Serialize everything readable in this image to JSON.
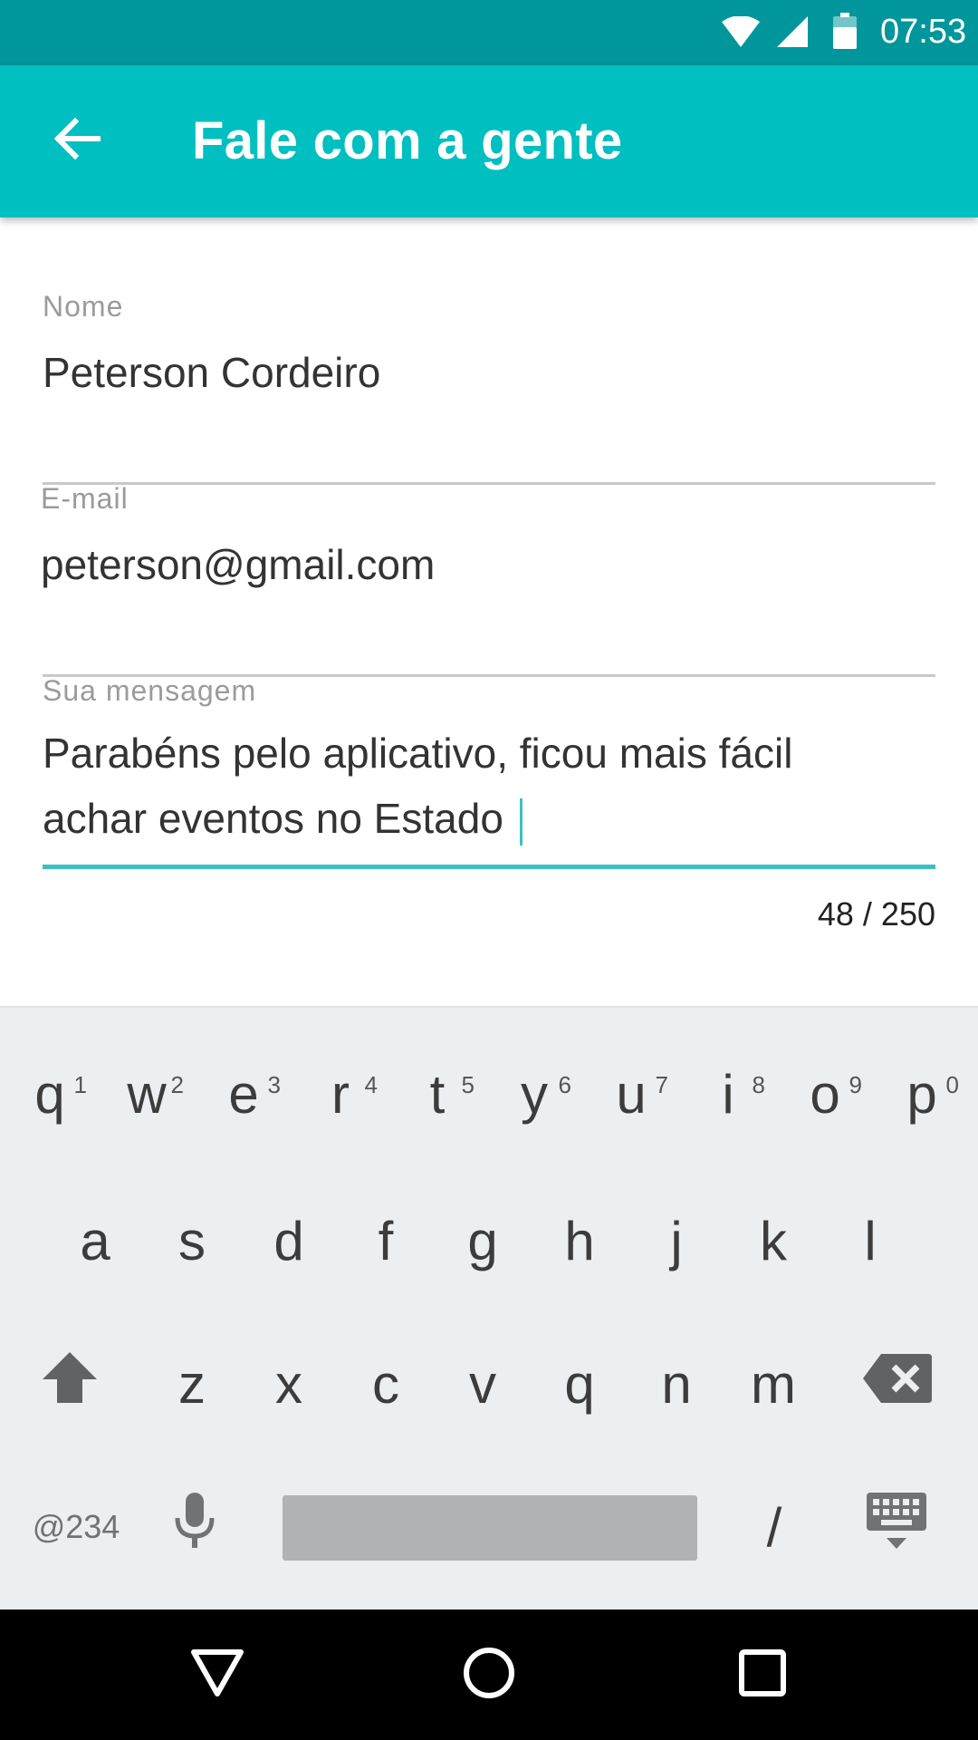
{
  "status_bar": {
    "time": "07:53",
    "icons": [
      "wifi-icon",
      "signal-icon",
      "battery-icon"
    ]
  },
  "app_bar": {
    "title": "Fale com a gente",
    "back_icon": "arrow-back-icon",
    "color": "#00bfc0"
  },
  "form": {
    "name": {
      "label": "Nome",
      "value": "Peterson Cordeiro"
    },
    "email": {
      "label": "E-mail",
      "value": "peterson@gmail.com"
    },
    "message": {
      "label": "Sua mensagem",
      "line1": "Parabéns pelo aplicativo, ficou mais fácil",
      "line2": "achar eventos no Estado",
      "counter": "48 / 250"
    },
    "accent_color": "#3cbfc0"
  },
  "keyboard": {
    "row1": [
      {
        "key": "q",
        "hint": "1"
      },
      {
        "key": "w",
        "hint": "2"
      },
      {
        "key": "e",
        "hint": "3"
      },
      {
        "key": "r",
        "hint": "4"
      },
      {
        "key": "t",
        "hint": "5"
      },
      {
        "key": "y",
        "hint": "6"
      },
      {
        "key": "u",
        "hint": "7"
      },
      {
        "key": "i",
        "hint": "8"
      },
      {
        "key": "o",
        "hint": "9"
      },
      {
        "key": "p",
        "hint": "0"
      }
    ],
    "row2": [
      "a",
      "s",
      "d",
      "f",
      "g",
      "h",
      "j",
      "k",
      "l"
    ],
    "row3": [
      "z",
      "x",
      "c",
      "v",
      "q",
      "n",
      "m"
    ],
    "symbols_label": "@234",
    "slash": "/",
    "icons": [
      "shift-icon",
      "backspace-icon",
      "microphone-icon",
      "keyboard-hide-icon"
    ]
  },
  "nav_bar": {
    "icons": [
      "back-triangle-icon",
      "home-circle-icon",
      "recents-square-icon"
    ]
  }
}
